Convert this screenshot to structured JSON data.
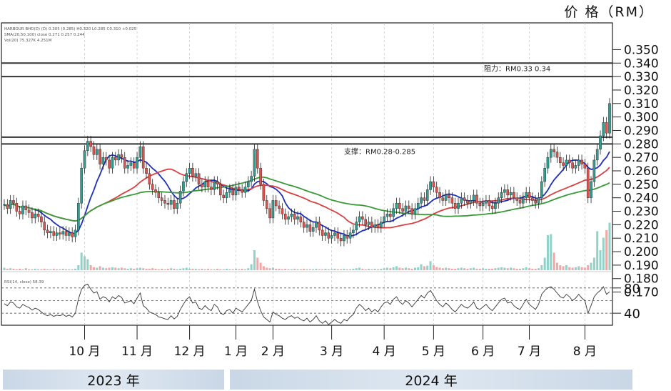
{
  "unit_label": "价 格（RM）",
  "year_bands": [
    "2023 年",
    "2024 年"
  ],
  "resistance_label": "阻力：RM0.33 0.34",
  "support_label": "支撑：RM0.28-0.285",
  "legend_lines": [
    "HARBOUR BHD(D) (D) 0.305 (0.285) H0.320 L0.285 C0.310 +0.025",
    "SMA(20,50,100) close  0.271  0.257  0.244",
    "Vol(20)  75.327K  4.251M"
  ],
  "indicator_label": "RSI(14, close)  58.39",
  "colors": {
    "up": "#2f9e90",
    "down": "#d9534f",
    "sma_fast": "#1f2fbf",
    "sma_mid": "#d84040",
    "sma_slow": "#3a9a3a",
    "rsi": "#333333"
  },
  "chart_data": {
    "type": "line",
    "title": "",
    "ylabel": "价 格（RM）",
    "xlabel": "",
    "ylim": [
      0.165,
      0.355
    ],
    "yticks": [
      "0.350",
      "0.340",
      "0.330",
      "0.320",
      "0.310",
      "0.300",
      "0.290",
      "0.280",
      "0.270",
      "0.260",
      "0.250",
      "0.240",
      "0.230",
      "0.220",
      "0.210",
      "0.200",
      "0.190",
      "0.180",
      "0.170"
    ],
    "ytick_values": [
      0.35,
      0.34,
      0.33,
      0.32,
      0.31,
      0.3,
      0.29,
      0.28,
      0.27,
      0.26,
      0.25,
      0.24,
      0.23,
      0.22,
      0.21,
      0.2,
      0.19,
      0.18,
      0.17
    ],
    "x_months": [
      "10 月",
      "11 月",
      "12 月",
      "1 月",
      "2 月",
      "3 月",
      "4 月",
      "5 月",
      "6 月",
      "7 月",
      "8 月"
    ],
    "x_month_index": [
      26,
      43,
      60,
      75,
      87,
      106,
      123,
      139,
      155,
      170,
      188
    ],
    "levels": [
      {
        "name": "resistance",
        "values": [
          0.33,
          0.34
        ]
      },
      {
        "name": "support",
        "values": [
          0.28,
          0.285
        ]
      }
    ],
    "close": [
      0.235,
      0.232,
      0.238,
      0.236,
      0.23,
      0.228,
      0.234,
      0.231,
      0.229,
      0.225,
      0.228,
      0.226,
      0.222,
      0.216,
      0.214,
      0.215,
      0.212,
      0.214,
      0.213,
      0.215,
      0.212,
      0.214,
      0.211,
      0.216,
      0.236,
      0.262,
      0.275,
      0.282,
      0.278,
      0.272,
      0.276,
      0.265,
      0.27,
      0.268,
      0.262,
      0.27,
      0.268,
      0.272,
      0.27,
      0.262,
      0.264,
      0.266,
      0.262,
      0.27,
      0.278,
      0.262,
      0.258,
      0.25,
      0.246,
      0.244,
      0.24,
      0.238,
      0.236,
      0.235,
      0.238,
      0.232,
      0.236,
      0.245,
      0.252,
      0.258,
      0.262,
      0.256,
      0.258,
      0.25,
      0.248,
      0.252,
      0.248,
      0.246,
      0.252,
      0.25,
      0.242,
      0.24,
      0.244,
      0.246,
      0.242,
      0.248,
      0.246,
      0.244,
      0.248,
      0.252,
      0.256,
      0.276,
      0.262,
      0.25,
      0.238,
      0.232,
      0.225,
      0.238,
      0.234,
      0.232,
      0.228,
      0.224,
      0.226,
      0.228,
      0.224,
      0.226,
      0.222,
      0.218,
      0.22,
      0.215,
      0.218,
      0.222,
      0.216,
      0.212,
      0.214,
      0.21,
      0.212,
      0.214,
      0.21,
      0.208,
      0.212,
      0.21,
      0.214,
      0.216,
      0.222,
      0.226,
      0.224,
      0.22,
      0.222,
      0.218,
      0.22,
      0.218,
      0.222,
      0.226,
      0.228,
      0.226,
      0.232,
      0.236,
      0.232,
      0.23,
      0.234,
      0.232,
      0.228,
      0.232,
      0.236,
      0.24,
      0.238,
      0.246,
      0.252,
      0.248,
      0.244,
      0.24,
      0.238,
      0.242,
      0.24,
      0.236,
      0.232,
      0.236,
      0.24,
      0.238,
      0.236,
      0.238,
      0.242,
      0.236,
      0.234,
      0.236,
      0.238,
      0.234,
      0.232,
      0.236,
      0.24,
      0.244,
      0.246,
      0.242,
      0.244,
      0.24,
      0.238,
      0.236,
      0.24,
      0.244,
      0.24,
      0.238,
      0.236,
      0.24,
      0.252,
      0.262,
      0.27,
      0.276,
      0.274,
      0.27,
      0.266,
      0.264,
      0.268,
      0.266,
      0.262,
      0.264,
      0.268,
      0.265,
      0.262,
      0.24,
      0.252,
      0.268,
      0.276,
      0.286,
      0.296,
      0.288,
      0.31
    ],
    "volume": [
      0.05,
      0.03,
      0.04,
      0.03,
      0.02,
      0.03,
      0.02,
      0.04,
      0.02,
      0.02,
      0.03,
      0.02,
      0.02,
      0.03,
      0.02,
      0.02,
      0.03,
      0.02,
      0.02,
      0.03,
      0.02,
      0.02,
      0.02,
      0.03,
      0.1,
      0.35,
      0.28,
      0.22,
      0.1,
      0.06,
      0.05,
      0.08,
      0.05,
      0.04,
      0.05,
      0.06,
      0.05,
      0.04,
      0.05,
      0.04,
      0.03,
      0.04,
      0.03,
      0.04,
      0.05,
      0.04,
      0.03,
      0.03,
      0.04,
      0.03,
      0.02,
      0.03,
      0.02,
      0.03,
      0.04,
      0.03,
      0.02,
      0.03,
      0.04,
      0.05,
      0.03,
      0.03,
      0.03,
      0.02,
      0.03,
      0.02,
      0.03,
      0.02,
      0.02,
      0.03,
      0.02,
      0.02,
      0.03,
      0.02,
      0.02,
      0.03,
      0.02,
      0.03,
      0.02,
      0.04,
      0.12,
      0.4,
      0.25,
      0.15,
      0.08,
      0.05,
      0.04,
      0.05,
      0.03,
      0.03,
      0.02,
      0.03,
      0.02,
      0.02,
      0.03,
      0.02,
      0.02,
      0.03,
      0.02,
      0.02,
      0.02,
      0.03,
      0.02,
      0.02,
      0.03,
      0.02,
      0.02,
      0.03,
      0.02,
      0.02,
      0.03,
      0.02,
      0.02,
      0.03,
      0.04,
      0.05,
      0.03,
      0.02,
      0.03,
      0.02,
      0.03,
      0.02,
      0.03,
      0.04,
      0.05,
      0.04,
      0.06,
      0.08,
      0.05,
      0.04,
      0.05,
      0.04,
      0.03,
      0.05,
      0.06,
      0.12,
      0.08,
      0.09,
      0.18,
      0.1,
      0.06,
      0.05,
      0.04,
      0.05,
      0.04,
      0.03,
      0.03,
      0.04,
      0.05,
      0.04,
      0.03,
      0.04,
      0.05,
      0.03,
      0.03,
      0.04,
      0.03,
      0.03,
      0.03,
      0.04,
      0.05,
      0.06,
      0.05,
      0.04,
      0.05,
      0.04,
      0.03,
      0.03,
      0.04,
      0.06,
      0.04,
      0.03,
      0.03,
      0.04,
      0.1,
      0.25,
      0.7,
      0.72,
      0.35,
      0.15,
      0.1,
      0.08,
      0.1,
      0.06,
      0.05,
      0.06,
      0.08,
      0.06,
      0.05,
      0.1,
      0.15,
      0.25,
      0.78,
      0.4,
      0.65,
      0.8,
      0.95
    ],
    "rsi": [
      55,
      52,
      58,
      56,
      50,
      48,
      54,
      51,
      49,
      45,
      48,
      46,
      42,
      38,
      36,
      38,
      35,
      37,
      36,
      38,
      35,
      37,
      34,
      40,
      62,
      78,
      84,
      86,
      78,
      72,
      74,
      62,
      66,
      64,
      58,
      66,
      63,
      68,
      65,
      56,
      58,
      60,
      55,
      64,
      72,
      52,
      48,
      42,
      40,
      38,
      34,
      33,
      31,
      30,
      36,
      31,
      35,
      46,
      54,
      62,
      66,
      56,
      58,
      48,
      46,
      52,
      47,
      44,
      54,
      50,
      40,
      38,
      44,
      46,
      40,
      48,
      45,
      42,
      48,
      54,
      60,
      78,
      58,
      44,
      34,
      30,
      26,
      42,
      38,
      36,
      32,
      30,
      34,
      36,
      32,
      34,
      30,
      28,
      32,
      26,
      30,
      36,
      28,
      24,
      28,
      22,
      26,
      30,
      26,
      24,
      30,
      28,
      34,
      38,
      48,
      54,
      50,
      44,
      48,
      42,
      46,
      42,
      50,
      56,
      58,
      54,
      62,
      66,
      58,
      54,
      60,
      56,
      50,
      56,
      62,
      68,
      64,
      72,
      76,
      68,
      60,
      54,
      50,
      56,
      52,
      46,
      42,
      48,
      54,
      50,
      48,
      52,
      58,
      48,
      46,
      50,
      54,
      48,
      44,
      50,
      56,
      62,
      64,
      56,
      58,
      52,
      48,
      46,
      54,
      62,
      54,
      50,
      46,
      54,
      70,
      76,
      80,
      82,
      78,
      72,
      66,
      64,
      70,
      66,
      60,
      64,
      70,
      64,
      60,
      40,
      52,
      66,
      72,
      76,
      82,
      70,
      74
    ]
  }
}
